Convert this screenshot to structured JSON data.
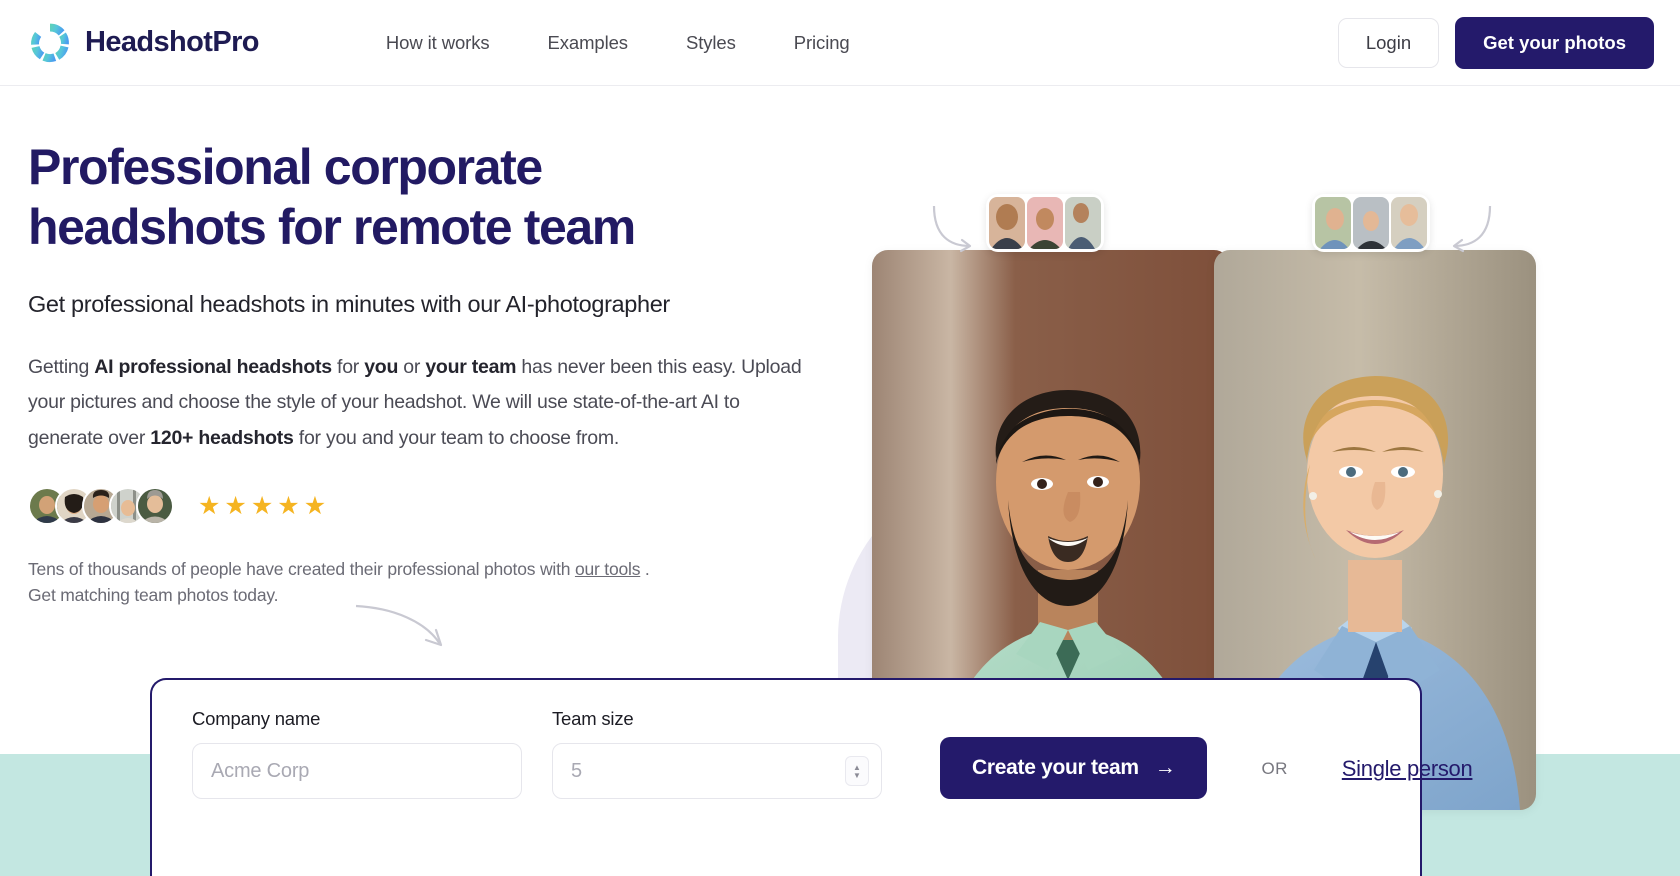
{
  "header": {
    "brand": "HeadshotPro",
    "logo_icon": "headshotpro-ring-logo",
    "nav": [
      {
        "label": "How it works"
      },
      {
        "label": "Examples"
      },
      {
        "label": "Styles"
      },
      {
        "label": "Pricing"
      }
    ],
    "login_label": "Login",
    "cta_label": "Get your photos"
  },
  "hero": {
    "headline_line1": "Professional corporate",
    "headline_line2": "headshots for remote team",
    "subheadline": "Get professional headshots in minutes with our AI-photographer",
    "body": {
      "p1_a": "Getting ",
      "p1_b": "AI professional headshots",
      "p1_c": " for ",
      "p1_d": "you",
      "p1_e": " or ",
      "p1_f": "your team",
      "p1_g": " has never been this easy. Upload your pictures and choose the style of your headshot. We will use state-of-the-art AI to generate over ",
      "p1_h": "120+ headshots",
      "p1_i": " for you and your team to choose from."
    },
    "rating_stars": "★★★★★",
    "star_count": 5,
    "star_color": "#f5b421",
    "footnote_a": "Tens of thousands of people have created their professional photos with ",
    "footnote_link": "our tools",
    "footnote_b": " . Get matching team photos today."
  },
  "form": {
    "company_label": "Company name",
    "company_placeholder": "Acme Corp",
    "team_label": "Team size",
    "team_placeholder": "5",
    "submit_label": "Create your team",
    "submit_arrow": "→",
    "or_label": "OR",
    "single_person_label": "Single person"
  },
  "colors": {
    "brand_navy": "#241a6b",
    "teal_band": "#c3e7e1",
    "star_gold": "#f5b421",
    "body_gray": "#4b4b55"
  },
  "photos": {
    "main_left_alt": "smiling-man-mint-shirt-headshot",
    "main_right_alt": "smiling-woman-blue-blazer-headshot",
    "strip_left_count": 3,
    "strip_right_count": 3
  }
}
